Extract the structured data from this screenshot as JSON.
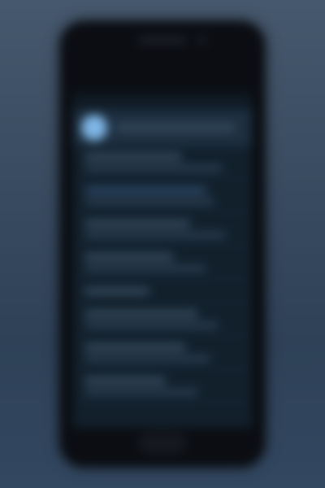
{
  "colors": {
    "background_top": "#46586d",
    "background_bottom": "#2e4157",
    "phone_body": "#0b0d12",
    "screen_bg": "#12202c",
    "header_bg": "#1d2f40",
    "avatar": "#7fb6e6",
    "text_placeholder": "#2c3f52",
    "accent": "#2f4d6e"
  },
  "header": {
    "avatar_icon": "avatar-icon"
  },
  "list": {
    "items": [
      {
        "kind": "row"
      },
      {
        "kind": "row"
      },
      {
        "kind": "row"
      },
      {
        "kind": "row"
      },
      {
        "kind": "section"
      },
      {
        "kind": "row"
      },
      {
        "kind": "row"
      },
      {
        "kind": "row"
      }
    ]
  }
}
